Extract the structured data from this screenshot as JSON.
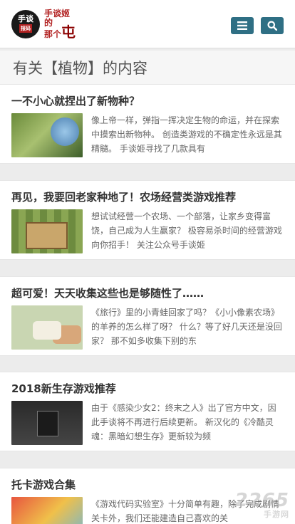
{
  "header": {
    "logo_seal_main": "手谈",
    "logo_seal_sub": "报码",
    "logo_line1": "手谈姬",
    "logo_line2": "的",
    "logo_line3": "那个",
    "logo_big": "屯",
    "menu_icon": "menu-icon",
    "search_icon": "search-icon",
    "accent_color": "#2f6f84"
  },
  "section": {
    "title": "有关【植物】的内容"
  },
  "articles": [
    {
      "title": "一不小心就捏出了新物种？",
      "excerpt": "像上帝一样，弹指一挥决定生物的命运，并在探索中摸索出新物种。 创造类游戏的不确定性永远是其精髓。 手谈姬寻找了几款具有"
    },
    {
      "title": "再见，我要回老家种地了！农场经营类游戏推荐",
      "excerpt": "想试试经营一个农场、一个部落，让家乡变得富饶，自己成为人生赢家？ 极容易杀时间的经营游戏向你招手！ 关注公众号手谈姬"
    },
    {
      "title": "超可爱！天天收集这些也是够随性了……",
      "excerpt": "《旅行》里的小青蛙回家了吗？《小小像素农场》的羊养的怎么样了呀？ 什么？等了好几天还是没回家？ 那不如多收集下别的东"
    },
    {
      "title": "2018新生存游戏推荐",
      "excerpt": "由于《感染少女2：终末之人》出了官方中文，因此手谈将不再进行后续更新。 新汉化的《冷酷灵魂：黑暗幻想生存》更新较为频"
    },
    {
      "title": "托卡游戏合集",
      "excerpt": "《游戏代码实验室》十分简单有趣，除了完成剧情关卡外，我们还能建造自己喜欢的关"
    }
  ],
  "watermark": {
    "brand": "2265",
    "sub": "手游网"
  }
}
